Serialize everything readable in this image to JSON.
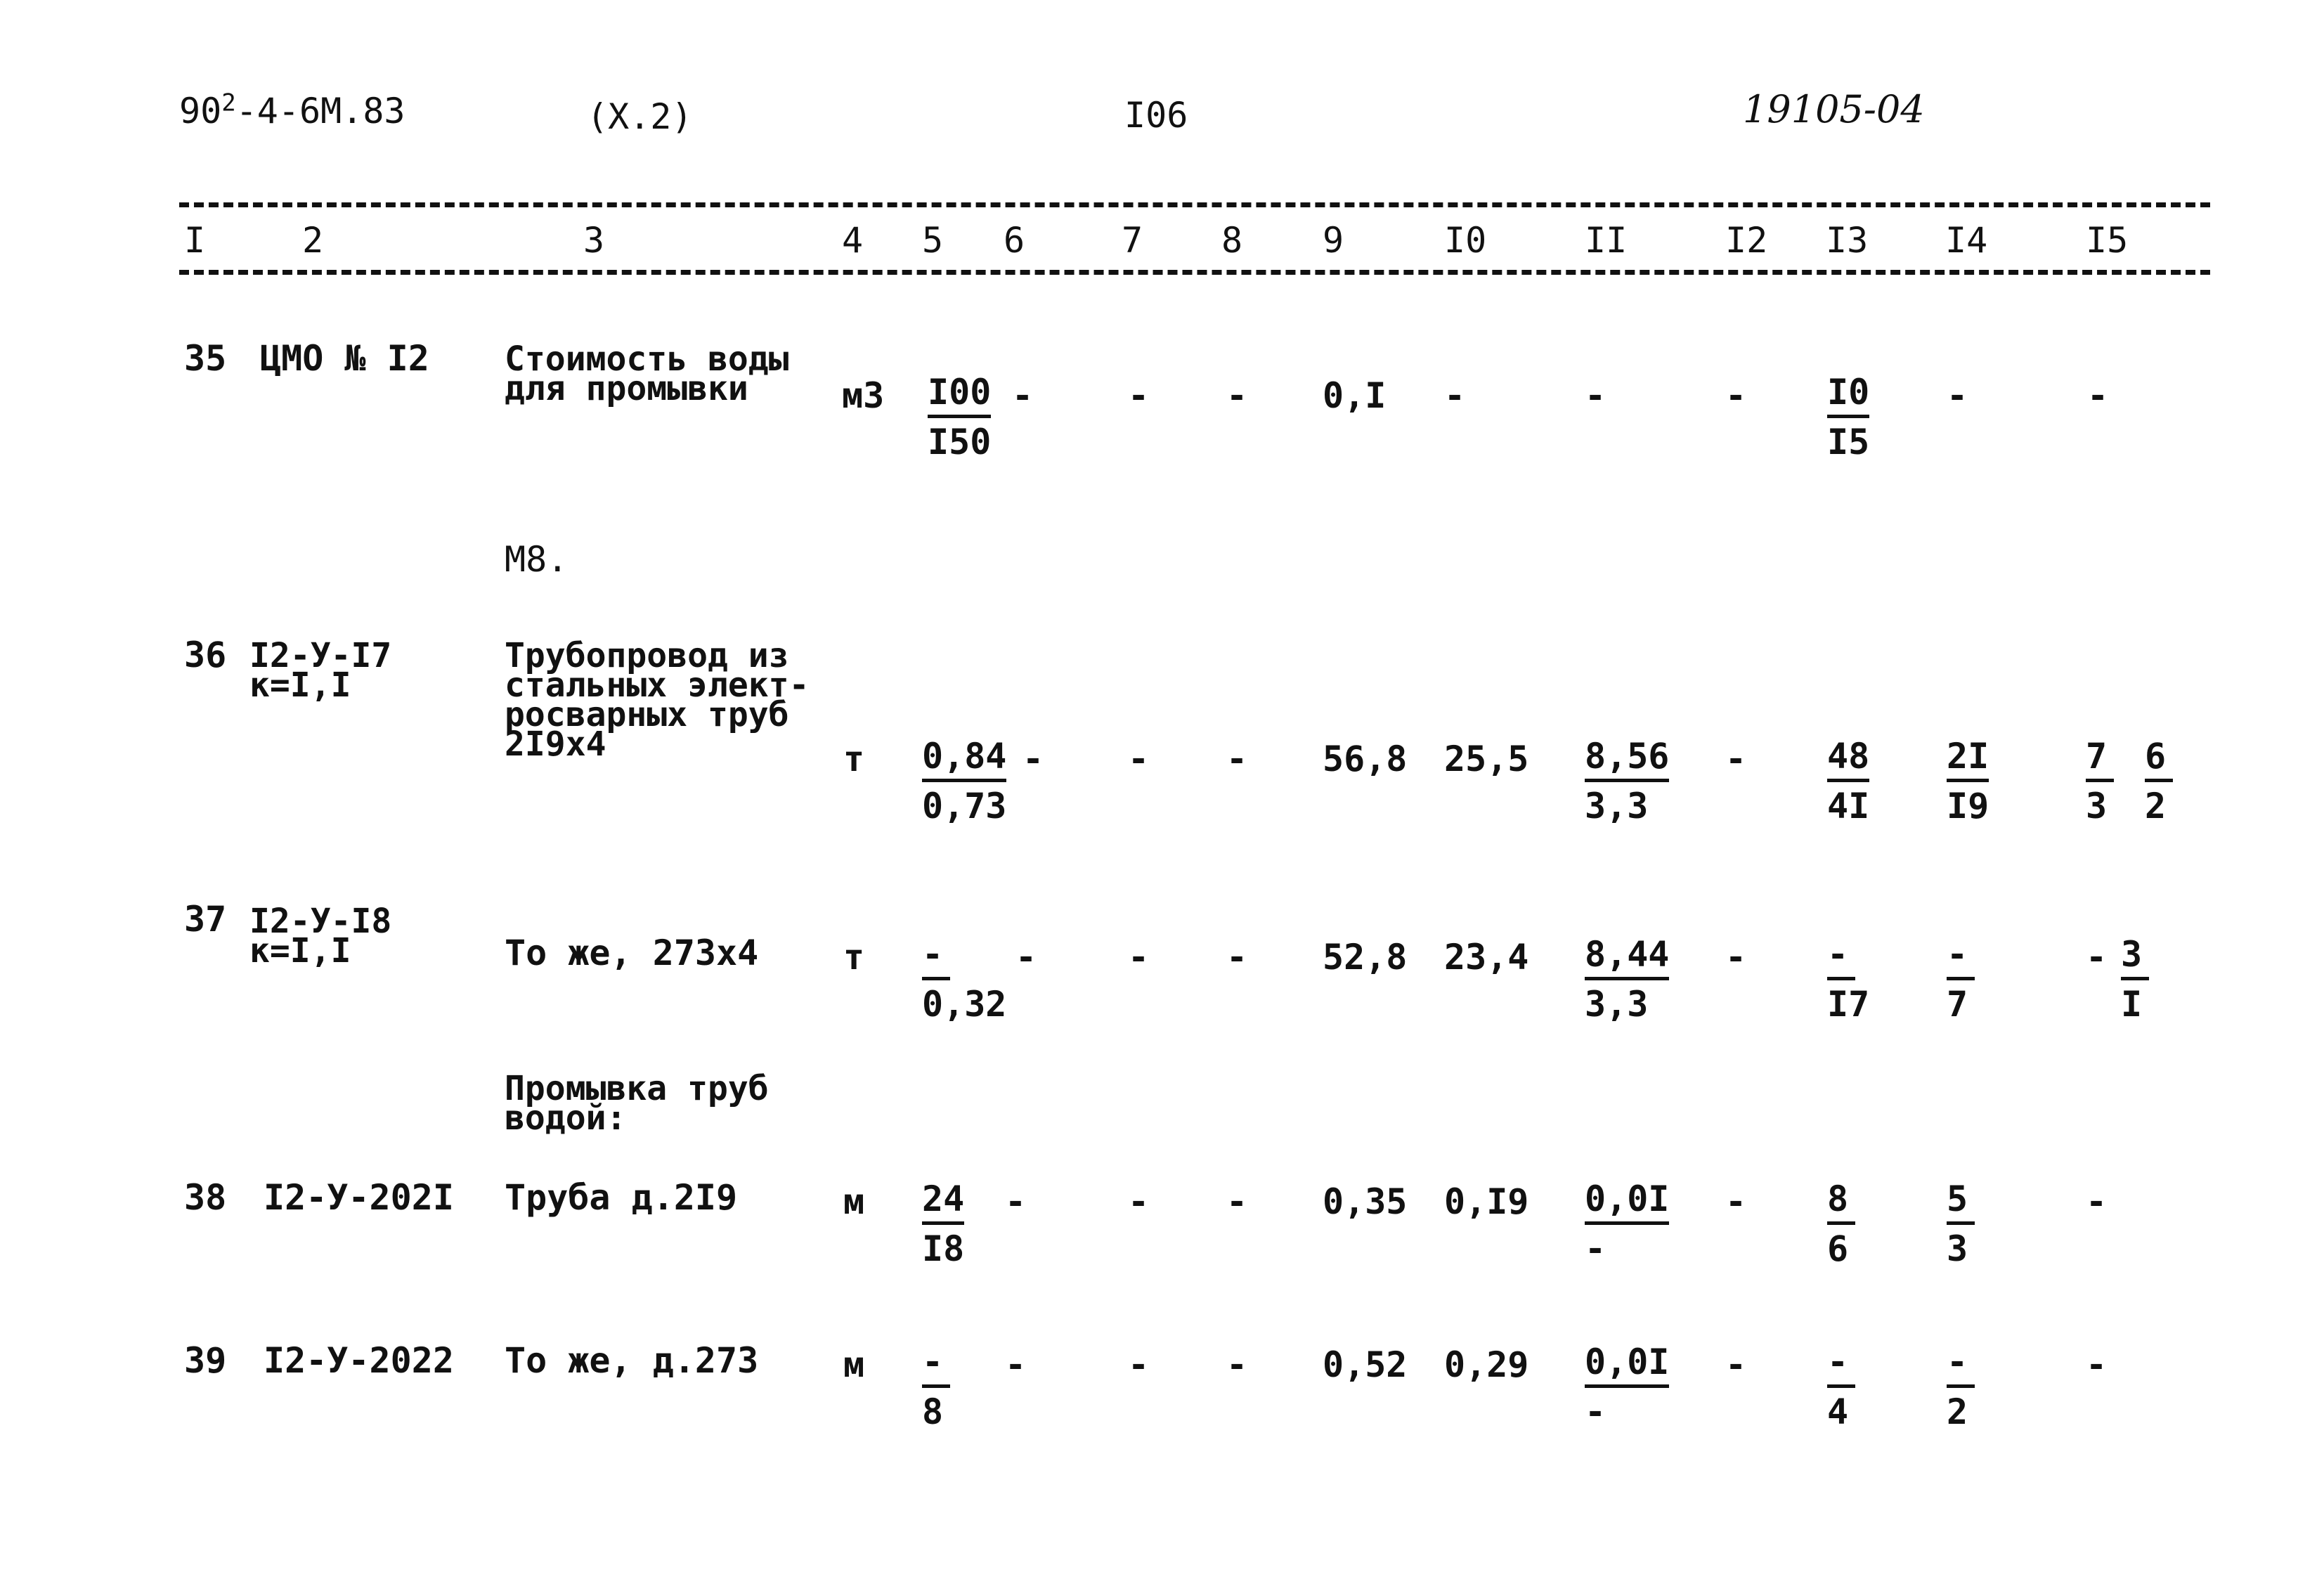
{
  "header": {
    "doc_code_prefix": "90",
    "doc_code_sup": "2",
    "doc_code_rest": "-4-6М.83",
    "section": "(Х.2)",
    "page_number": "I06",
    "handwritten_number": "19105-04"
  },
  "columns": [
    "I",
    "2",
    "3",
    "4",
    "5",
    "6",
    "7",
    "8",
    "9",
    "I0",
    "II",
    "I2",
    "I3",
    "I4",
    "I5"
  ],
  "sections": {
    "m8": "М8.",
    "flushing_l1": "Промывка труб",
    "flushing_l2": "водой:"
  },
  "rows": [
    {
      "num": "35",
      "code_l1": "ЦМО № I2",
      "code_l2": "",
      "desc_l1": "Стоимость воды",
      "desc_l2": "для промывки",
      "desc_l3": "",
      "desc_l4": "",
      "unit": "м3",
      "c5_num": "I00",
      "c5_den": "I50",
      "c6": "-",
      "c7": "-",
      "c8": "-",
      "c9": "0,I",
      "c10": "-",
      "c11_num": "-",
      "c11_den": "",
      "c12": "-",
      "c13_num": "I0",
      "c13_den": "I5",
      "c14_num": "-",
      "c14_den": "",
      "c15a_num": "-",
      "c15a_den": "",
      "c15b_num": "",
      "c15b_den": ""
    },
    {
      "num": "36",
      "code_l1": "I2-У-I7",
      "code_l2": "к=I,I",
      "desc_l1": "Трубопровод из",
      "desc_l2": "стальных элект-",
      "desc_l3": "росварных труб",
      "desc_l4": "2I9х4",
      "unit": "т",
      "c5_num": "0,84",
      "c5_den": "0,73",
      "c6": "-",
      "c7": "-",
      "c8": "-",
      "c9": "56,8",
      "c10": "25,5",
      "c11_num": "8,56",
      "c11_den": "3,3",
      "c12": "-",
      "c13_num": "48",
      "c13_den": "4I",
      "c14_num": "2I",
      "c14_den": "I9",
      "c15a_num": "7",
      "c15a_den": "3",
      "c15b_num": "6",
      "c15b_den": "2"
    },
    {
      "num": "37",
      "code_l1": "I2-У-I8",
      "code_l2": "к=I,I",
      "desc_l1": "То же, 273х4",
      "desc_l2": "",
      "desc_l3": "",
      "desc_l4": "",
      "unit": "т",
      "c5_num": "-",
      "c5_den": "0,32",
      "c6": "-",
      "c7": "-",
      "c8": "-",
      "c9": "52,8",
      "c10": "23,4",
      "c11_num": "8,44",
      "c11_den": "3,3",
      "c12": "-",
      "c13_num": "-",
      "c13_den": "I7",
      "c14_num": "-",
      "c14_den": "7",
      "c15a_num": "-",
      "c15a_den": "",
      "c15b_num": "3",
      "c15b_den": "I"
    },
    {
      "num": "38",
      "code_l1": "I2-У-202I",
      "code_l2": "",
      "desc_l1": "Труба д.2I9",
      "desc_l2": "",
      "desc_l3": "",
      "desc_l4": "",
      "unit": "м",
      "c5_num": "24",
      "c5_den": "I8",
      "c6": "-",
      "c7": "-",
      "c8": "-",
      "c9": "0,35",
      "c10": "0,I9",
      "c11_num": "0,0I",
      "c11_den": "-",
      "c12": "-",
      "c13_num": "8",
      "c13_den": "6",
      "c14_num": "5",
      "c14_den": "3",
      "c15a_num": "-",
      "c15a_den": "",
      "c15b_num": "",
      "c15b_den": ""
    },
    {
      "num": "39",
      "code_l1": "I2-У-2022",
      "code_l2": "",
      "desc_l1": "То же, д.273",
      "desc_l2": "",
      "desc_l3": "",
      "desc_l4": "",
      "unit": "м",
      "c5_num": "-",
      "c5_den": "8",
      "c6": "-",
      "c7": "-",
      "c8": "-",
      "c9": "0,52",
      "c10": "0,29",
      "c11_num": "0,0I",
      "c11_den": "-",
      "c12": "-",
      "c13_num": "-",
      "c13_den": "4",
      "c14_num": "-",
      "c14_den": "2",
      "c15a_num": "-",
      "c15a_den": "",
      "c15b_num": "",
      "c15b_den": ""
    }
  ]
}
